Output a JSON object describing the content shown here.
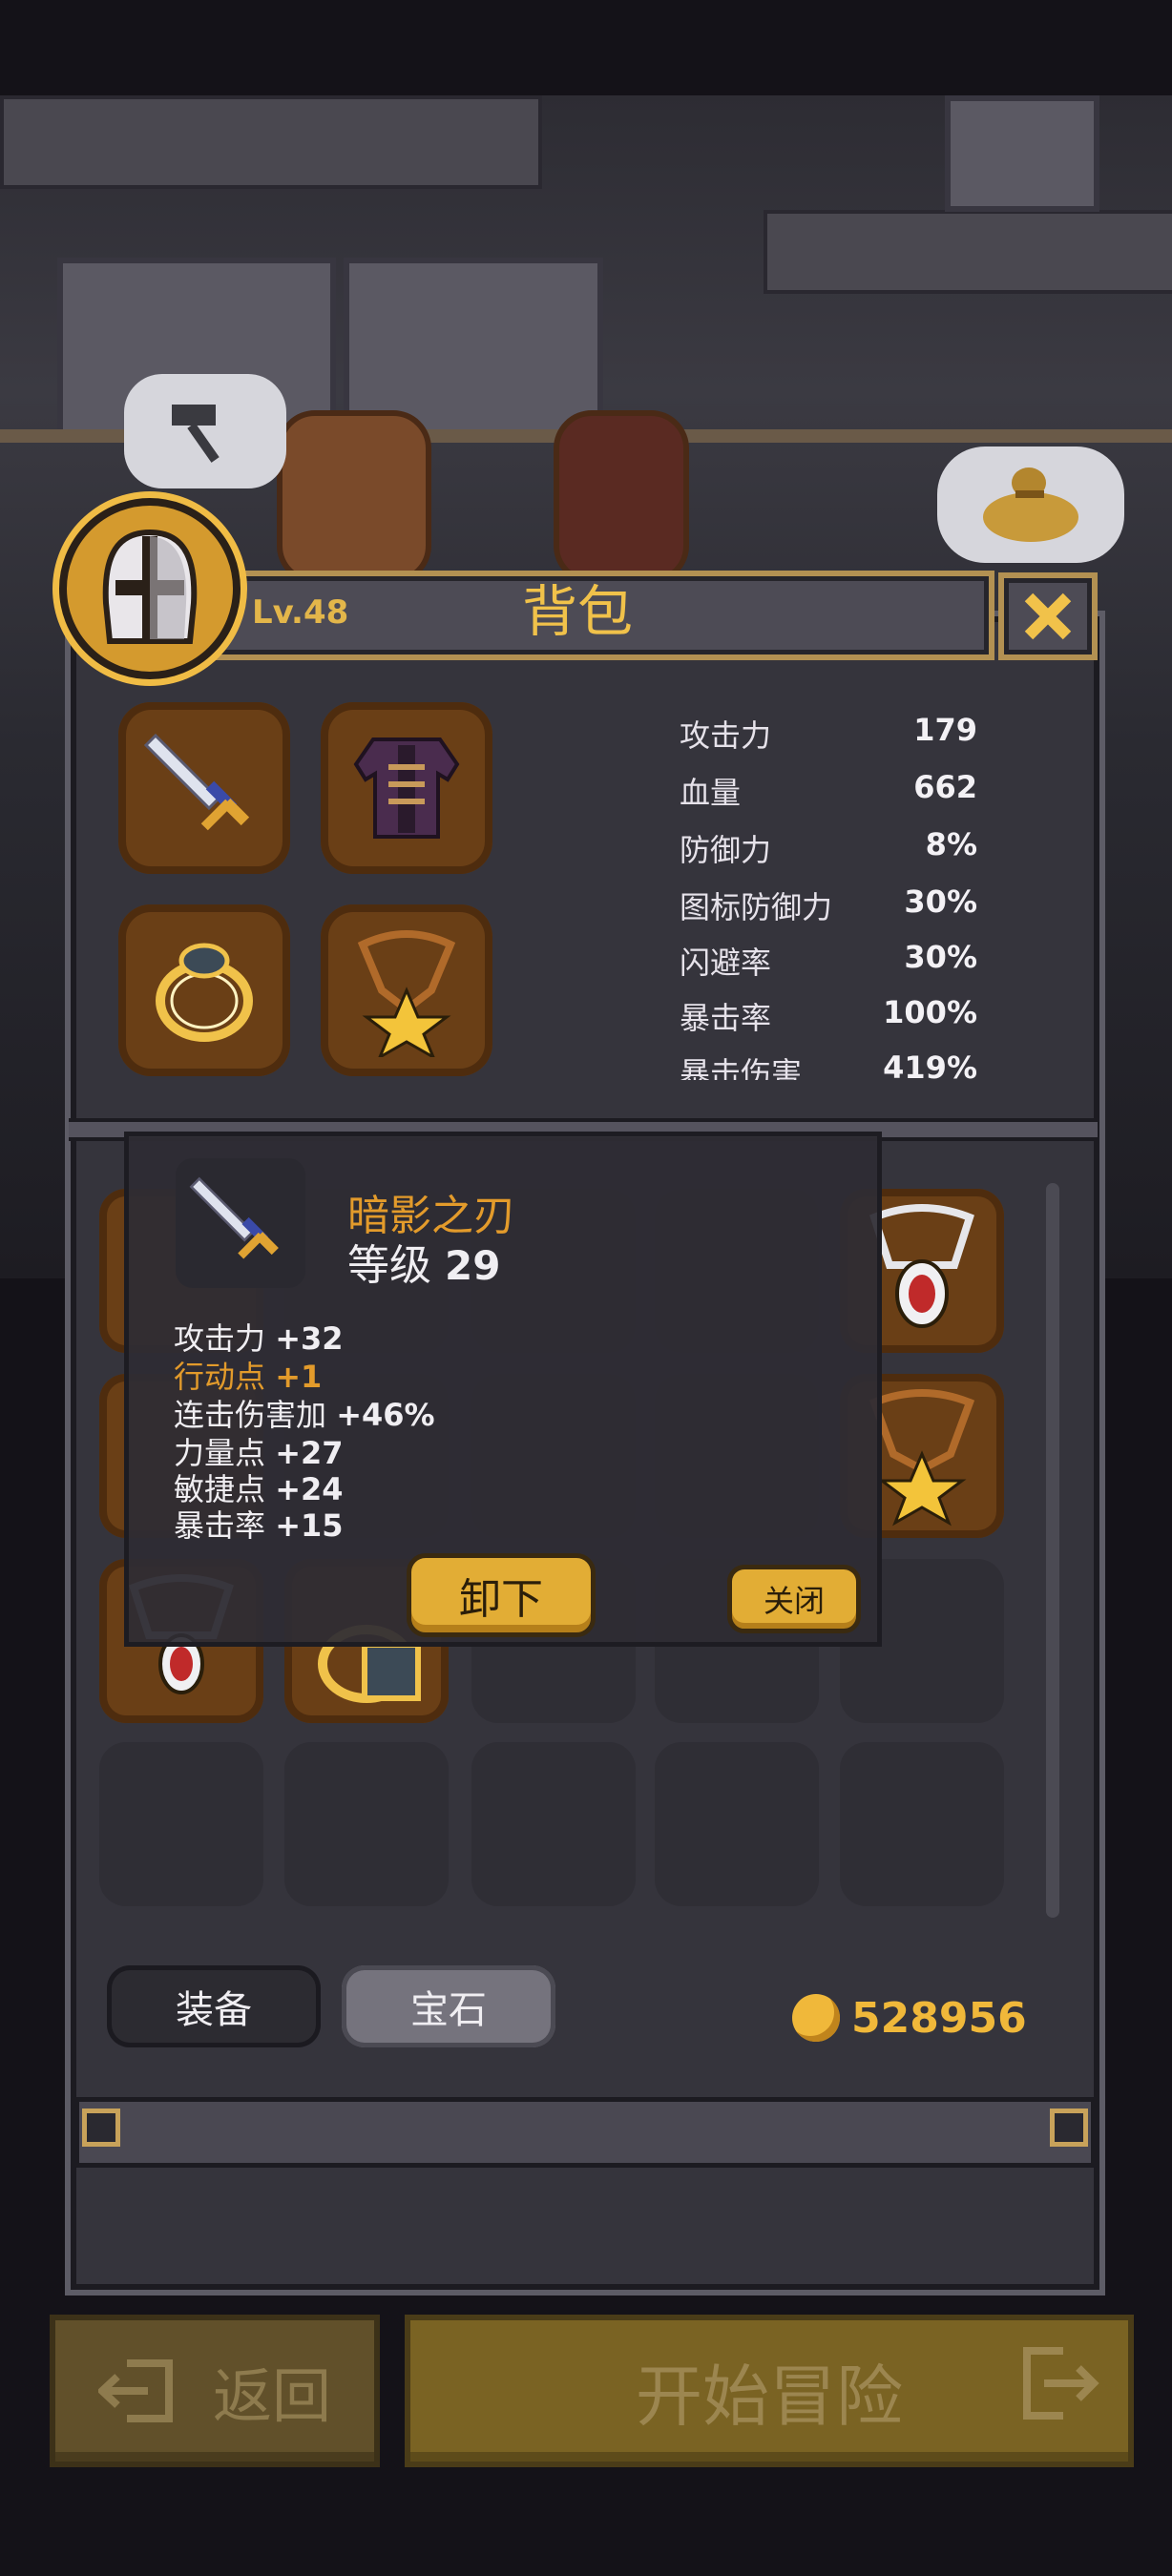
{
  "header": {
    "level": "Lv.48",
    "title": "背包"
  },
  "stats": [
    {
      "label": "攻击力",
      "value": "179"
    },
    {
      "label": "血量",
      "value": "662"
    },
    {
      "label": "防御力",
      "value": "8%"
    },
    {
      "label": "图标防御力",
      "value": "30%"
    },
    {
      "label": "闪避率",
      "value": "30%"
    },
    {
      "label": "暴击率",
      "value": "100%"
    },
    {
      "label": "暴击伤害",
      "value": "419%"
    }
  ],
  "tooltip": {
    "name": "暗影之刃",
    "level_label": "等级",
    "level_value": "29",
    "lines": [
      {
        "label": "攻击力",
        "value": "+32"
      },
      {
        "label": "行动点",
        "value": "+1"
      },
      {
        "label": "连击伤害加",
        "value": "+46%"
      },
      {
        "label": "力量点",
        "value": "+27"
      },
      {
        "label": "敏捷点",
        "value": "+24"
      },
      {
        "label": "暴击率",
        "value": "+15"
      }
    ],
    "unequip_label": "卸下",
    "close_label": "关闭"
  },
  "tabs": {
    "equipment": "装备",
    "gems": "宝石"
  },
  "gold": "528956",
  "footer": {
    "back_label": "返回",
    "start_label": "开始冒险"
  },
  "colors": {
    "accent_gold": "#f1c24a",
    "slot_brown": "#6a3f16",
    "panel": "#35343c",
    "highlight_orange": "#e39b2b"
  }
}
